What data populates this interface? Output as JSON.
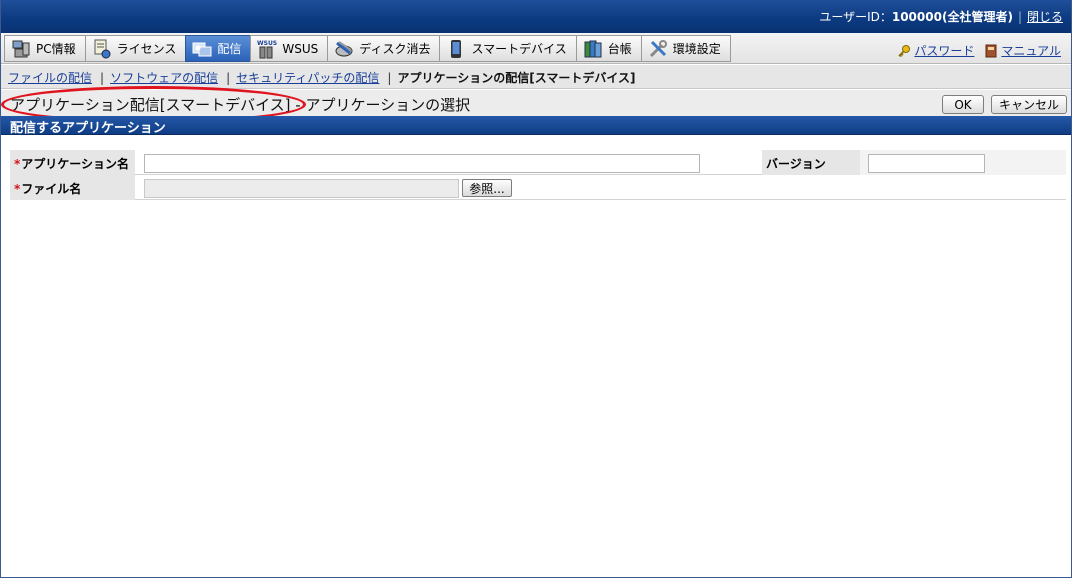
{
  "header": {
    "user_label": "ユーザーID：",
    "user_id": "100000(全社管理者)",
    "close_link": "閉じる"
  },
  "menu": {
    "tabs": [
      {
        "label": "PC情報",
        "icon": "pc-info-icon"
      },
      {
        "label": "ライセンス",
        "icon": "license-icon"
      },
      {
        "label": "配信",
        "icon": "delivery-icon",
        "active": true
      },
      {
        "label": "WSUS",
        "icon": "wsus-icon"
      },
      {
        "label": "ディスク消去",
        "icon": "disk-erase-icon"
      },
      {
        "label": "スマートデバイス",
        "icon": "smart-device-icon"
      },
      {
        "label": "台帳",
        "icon": "ledger-icon"
      },
      {
        "label": "環境設定",
        "icon": "settings-icon"
      }
    ],
    "password_link": "パスワード",
    "manual_link": "マニュアル"
  },
  "subnav": {
    "items": [
      "ファイルの配信",
      "ソフトウェアの配信",
      "セキュリティパッチの配信"
    ],
    "current": "アプリケーションの配信[スマートデバイス]"
  },
  "page": {
    "title": "アプリケーション配信[スマートデバイス] - アプリケーションの選択",
    "ok_button": "OK",
    "cancel_button": "キャンセル"
  },
  "section": {
    "title": "配信するアプリケーション"
  },
  "form": {
    "required_mark": "*",
    "app_name_label": "アプリケーション名",
    "app_name_value": "",
    "version_label": "バージョン",
    "version_value": "",
    "file_name_label": "ファイル名",
    "file_name_value": "",
    "browse_button": "参照..."
  },
  "colors": {
    "header_blue": "#0c3a80",
    "active_tab": "#2b62b8",
    "highlight_oval": "#e0141e",
    "required": "#d2141e",
    "link": "#1a3f99"
  }
}
